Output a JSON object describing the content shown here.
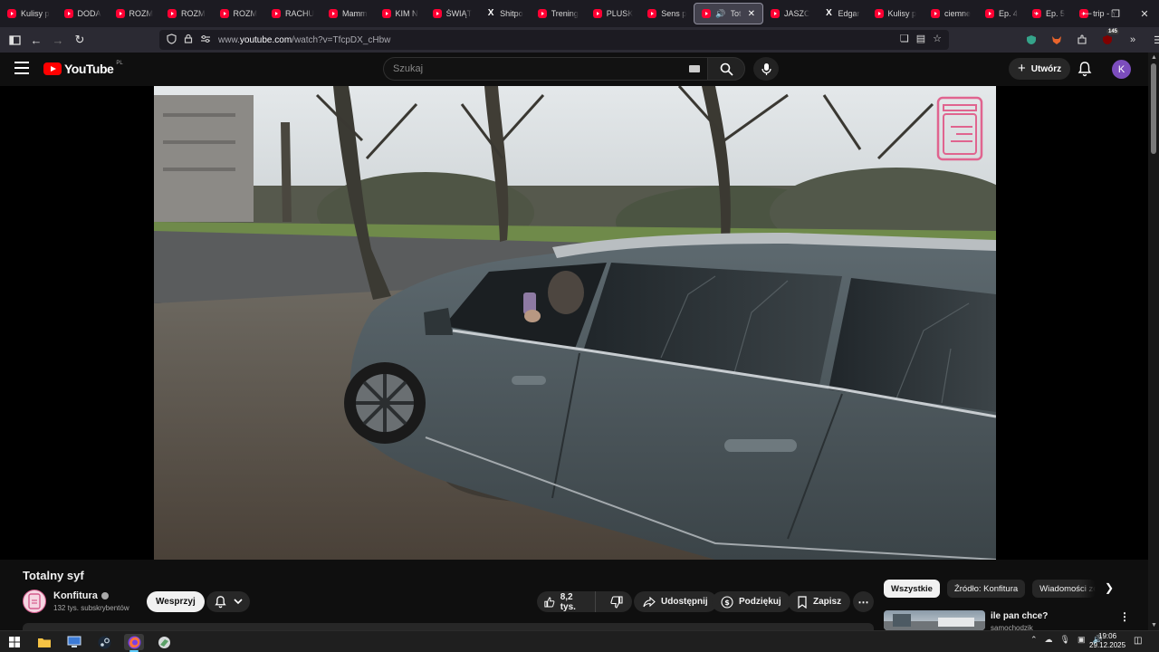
{
  "browser": {
    "tabs": [
      {
        "label": "Kulisy p",
        "icon": "youtube-icon"
      },
      {
        "label": "DODA",
        "icon": "youtube-icon"
      },
      {
        "label": "ROZM",
        "icon": "youtube-icon"
      },
      {
        "label": "ROZM",
        "icon": "youtube-icon"
      },
      {
        "label": "ROZM",
        "icon": "youtube-icon"
      },
      {
        "label": "RACHU",
        "icon": "youtube-icon"
      },
      {
        "label": "Mamm",
        "icon": "youtube-icon"
      },
      {
        "label": "KIM N",
        "icon": "youtube-icon"
      },
      {
        "label": "ŚWIĄT",
        "icon": "youtube-icon"
      },
      {
        "label": "Shitpo",
        "icon": "x-icon"
      },
      {
        "label": "Trening",
        "icon": "youtube-icon"
      },
      {
        "label": "PLUSK",
        "icon": "youtube-icon"
      },
      {
        "label": "Sens p",
        "icon": "youtube-icon"
      },
      {
        "label": "Tot",
        "icon": "youtube-icon",
        "active": true
      },
      {
        "label": "JASZC",
        "icon": "youtube-icon"
      },
      {
        "label": "Edgar",
        "icon": "x-icon"
      },
      {
        "label": "Kulisy p",
        "icon": "youtube-icon"
      },
      {
        "label": "ciemne",
        "icon": "youtube-icon"
      },
      {
        "label": "Ep. 4",
        "icon": "youtube-icon"
      },
      {
        "label": "Ep. 5",
        "icon": "youtube-icon"
      },
      {
        "label": "trip - Y",
        "icon": "youtube-icon"
      }
    ],
    "url_prefix": "www.",
    "url_host": "youtube.com",
    "url_path": "/watch?v=TfcpDX_cHbw",
    "extensions_badge": "145"
  },
  "youtube": {
    "logo_text": "YouTube",
    "country_code": "PL",
    "search_placeholder": "Szukaj",
    "create_label": "Utwórz",
    "avatar_letter": "K",
    "accent_color": "#ff0000"
  },
  "video": {
    "title": "Totalny syf",
    "channel": {
      "name": "Konfitura",
      "subscribers": "132 tys. subskrybentów",
      "verified": true
    },
    "support_label": "Wesprzyj",
    "likes": "8,2 tys.",
    "share_label": "Udostępnij",
    "thanks_label": "Podziękuj",
    "save_label": "Zapisz"
  },
  "recommendations": {
    "chips": [
      {
        "label": "Wszystkie",
        "active": true
      },
      {
        "label": "Źródło: Konfitura",
        "active": false
      },
      {
        "label": "Wiadomości ze",
        "active": false
      }
    ],
    "first_item": {
      "title": "ile pan chce?",
      "channel": "samochodzik"
    }
  },
  "taskbar": {
    "time": "19:06",
    "date": "29.12.2025"
  }
}
